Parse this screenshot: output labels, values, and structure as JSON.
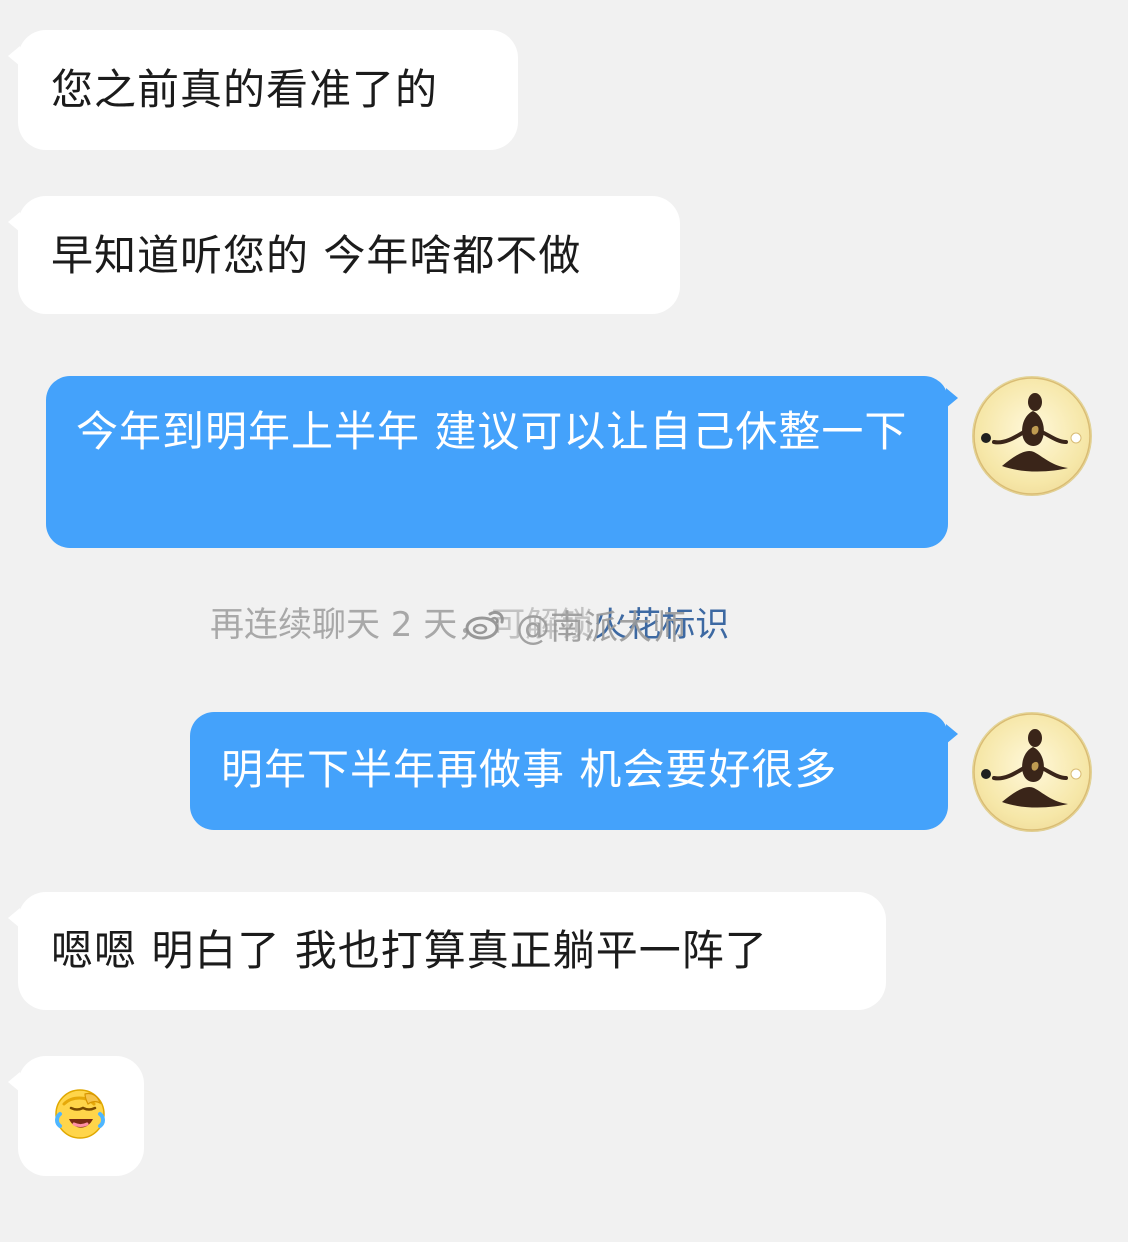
{
  "messages": [
    {
      "side": "left",
      "text": "您之前真的看准了的"
    },
    {
      "side": "left",
      "text": "早知道听您的 今年啥都不做"
    },
    {
      "side": "right",
      "text": "今年到明年上半年 建议可以让自己休整一下"
    },
    {
      "side": "right",
      "text": "明年下半年再做事 机会要好很多"
    },
    {
      "side": "left",
      "text": "嗯嗯 明白了 我也打算真正躺平一阵了"
    },
    {
      "side": "left",
      "emoji": "face-palm-laughing-icon"
    }
  ],
  "system_notice": {
    "prefix": "再连续聊天 2 天，",
    "hidden_middle": "可解锁",
    "highlight": "火花标识"
  },
  "watermark": {
    "text": "@南派大师",
    "icon": "weibo-logo-icon"
  },
  "avatar": {
    "icon": "meditation-figure-icon"
  },
  "colors": {
    "background": "#f1f1f1",
    "incoming_bubble": "#ffffff",
    "outgoing_bubble": "#44a2fb",
    "outgoing_text": "#ffffff",
    "notice_text": "#a8a8a8",
    "notice_highlight": "#3d69a2"
  }
}
